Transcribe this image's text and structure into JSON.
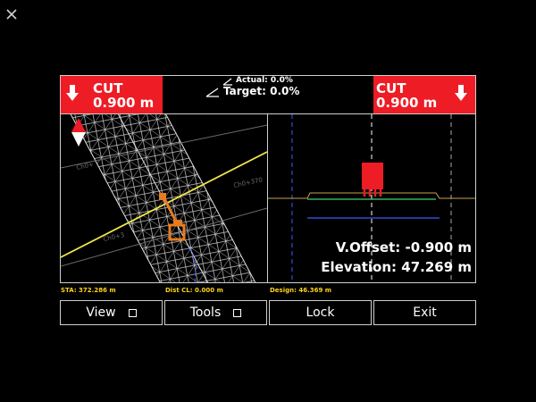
{
  "cut_left": {
    "label": "CUT",
    "value": "0.900 m"
  },
  "cut_right": {
    "label": "CUT",
    "value": "0.900 m"
  },
  "grade": {
    "actual": "Actual: 0.0%",
    "target": "Target: 0.0%"
  },
  "plan_labels": {
    "a": "Ch0+",
    "b": "Ch0+370",
    "c": "Ch0+3"
  },
  "readouts": {
    "v_offset": "V.Offset: -0.900 m",
    "elevation": "Elevation: 47.269 m"
  },
  "status": {
    "sta": "STA: 372.286 m",
    "dist_cl": "Dist CL: 0.000 m",
    "design": "Design: 46.369 m"
  },
  "buttons": [
    {
      "label": "View",
      "has_checkbox": true
    },
    {
      "label": "Tools",
      "has_checkbox": true
    },
    {
      "label": "Lock",
      "has_checkbox": false
    },
    {
      "label": "Exit",
      "has_checkbox": false
    }
  ],
  "colors": {
    "cut_red": "#ee1c25",
    "status_yellow": "#ffd21e",
    "centerline_yellow": "#f2e64a"
  }
}
